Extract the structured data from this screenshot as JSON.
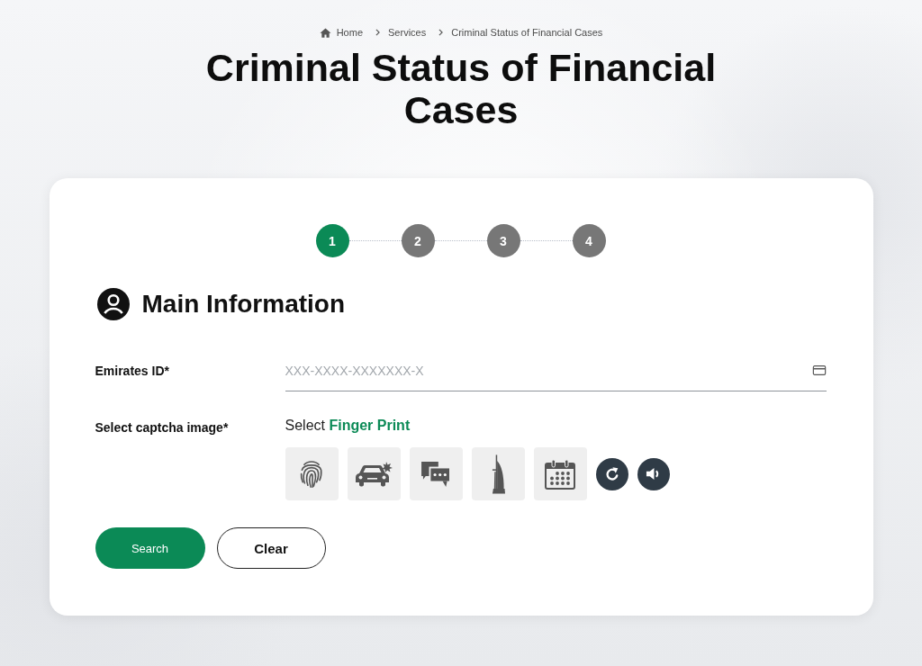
{
  "breadcrumb": [
    {
      "kind": "home",
      "label": "Home"
    },
    {
      "kind": "link",
      "label": "Services"
    },
    {
      "kind": "current",
      "label": "Criminal Status of Financial Cases"
    }
  ],
  "title": "Criminal Status of Financial Cases",
  "steps": [
    {
      "label": "1",
      "selected": true
    },
    {
      "label": "2",
      "selected": false
    },
    {
      "label": "3",
      "selected": false
    },
    {
      "label": "4",
      "selected": false
    }
  ],
  "section": {
    "title": "Main Information"
  },
  "fields": [
    {
      "kind": "text",
      "label": "Emirates ID*",
      "placeholder": "XXX-XXXX-XXXXXXX-X"
    },
    {
      "kind": "captcha",
      "label": "Select captcha image*",
      "prompt": "Select **Finger Print**",
      "images": [
        {
          "kind": "fingerprint",
          "selected": false
        },
        {
          "kind": "car",
          "selected": false
        },
        {
          "kind": "chat",
          "selected": false
        },
        {
          "kind": "tower",
          "selected": false
        },
        {
          "kind": "calendar",
          "selected": false
        }
      ]
    }
  ],
  "buttons": [
    {
      "kind": "primary",
      "label": "Search"
    },
    {
      "kind": "secondary",
      "label": "Clear"
    }
  ]
}
